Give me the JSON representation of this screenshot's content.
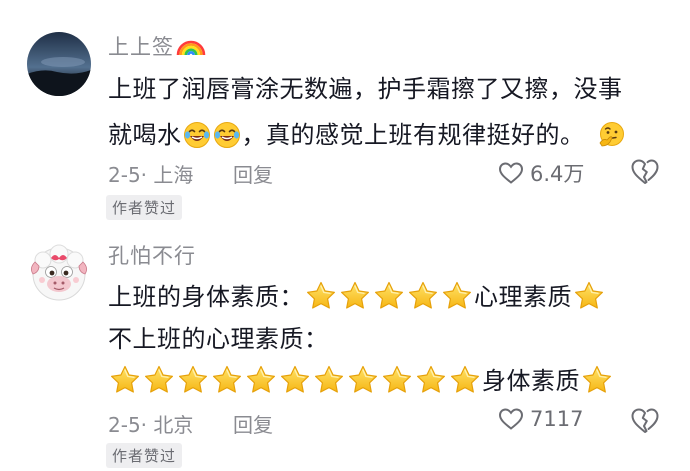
{
  "comments": [
    {
      "username": "上上签",
      "lines": [
        {
          "text": "上班了润唇膏涂无数遍，护手霜擦了又擦，没事"
        },
        {
          "before": "就喝水",
          "after": "，真的感觉上班有规律挺好的。"
        }
      ],
      "date_location": "2-5· 上海",
      "reply_label": "回复",
      "likes": "6.4万",
      "badge": "作者赞过"
    },
    {
      "username": "孔怕不行",
      "lines": [
        {
          "before": "上班的身体素质：",
          "stars_a": 5,
          "after": "心理素质",
          "stars_b": 1
        },
        {
          "text": "不上班的心理素质："
        },
        {
          "stars_a": 11,
          "after": "身体素质",
          "stars_b": 1
        }
      ],
      "date_location": "2-5· 北京",
      "reply_label": "回复",
      "likes": "7117",
      "badge": "作者赞过"
    }
  ],
  "icons": {
    "rainbow": "rainbow-emoji-icon",
    "laugh": "tears-of-joy-emoji-icon",
    "thinking": "thinking-face-emoji-icon",
    "star": "star-emoji-icon",
    "like": "heart-outline-icon",
    "dislike": "broken-heart-icon"
  }
}
